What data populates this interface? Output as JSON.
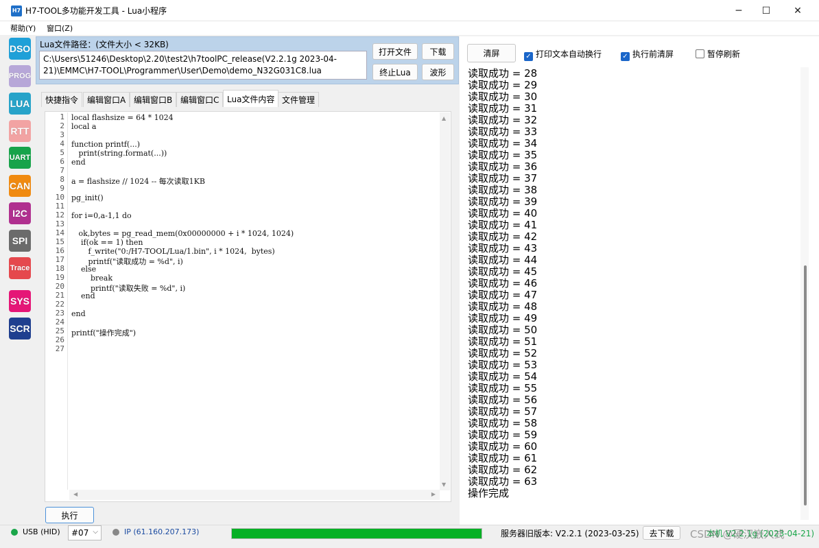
{
  "window": {
    "icon_text": "H7",
    "title": "H7-TOOL多功能开发工具 - Lua小程序",
    "minimize": "─",
    "maximize": "☐",
    "close": "✕"
  },
  "menu": [
    "帮助(Y)",
    "窗口(Z)"
  ],
  "tools": [
    {
      "label": "DSO",
      "color": "#1fa0d8"
    },
    {
      "label": "PROG",
      "color": "#b7a7d8"
    },
    {
      "label": "LUA",
      "color": "#27a3c9"
    },
    {
      "label": "RTT",
      "color": "#f2a3a3"
    },
    {
      "label": "UART",
      "color": "#17a34a"
    },
    {
      "label": "CAN",
      "color": "#f08a10"
    },
    {
      "label": "I2C",
      "color": "#b0308f"
    },
    {
      "label": "SPI",
      "color": "#6b6b6b"
    },
    {
      "label": "Trace",
      "color": "#e5484d"
    },
    {
      "label": "SYS",
      "color": "#e51677"
    },
    {
      "label": "SCR",
      "color": "#1f3f8f"
    }
  ],
  "path": {
    "label": "Lua文件路径：(文件大小 < 32KB)",
    "value_line1": "C:\\Users\\51246\\Desktop\\2.20\\test2\\h7toolPC_release(V2.2.1g 2023-04-",
    "value_line2": "21)\\EMMC\\H7-TOOL\\Programmer\\User\\Demo\\demo_N32G031C8.lua"
  },
  "buttons": {
    "open_file": "打开文件",
    "download": "下载",
    "stop_lua": "终止Lua",
    "waveform": "波形",
    "execute": "执行",
    "clear_screen": "清屏",
    "go_download": "去下载"
  },
  "tabs": [
    "快捷指令",
    "编辑窗口A",
    "编辑窗口B",
    "编辑窗口C",
    "Lua文件内容",
    "文件管理"
  ],
  "active_tab": "Lua文件内容",
  "code_lines": [
    "local flashsize = 64 * 1024",
    "local a",
    "",
    "function printf(...)",
    "   print(string.format(...))",
    "end",
    "",
    "a = flashsize // 1024 -- 每次读取1KB",
    "",
    "pg_init()",
    "",
    "for i=0,a-1,1 do",
    "",
    "   ok,bytes = pg_read_mem(0x00000000 + i * 1024, 1024)",
    "    if(ok == 1) then",
    "       f_write(\"0:/H7-TOOL/Lua/1.bin\", i * 1024,  bytes)",
    "       printf(\"读取成功 = %d\", i)",
    "    else",
    "        break",
    "        printf(\"读取失败 = %d\", i)",
    "    end",
    "",
    "end",
    "",
    "printf(\"操作完成\")",
    "",
    ""
  ],
  "line_numbers": [
    "1",
    "2",
    "3",
    "4",
    "5",
    "6",
    "7",
    "8",
    "9",
    "10",
    "11",
    "12",
    "13",
    "14",
    "15",
    "16",
    "17",
    "18",
    "19",
    "20",
    "21",
    "22",
    "23",
    "24",
    "25",
    "26",
    "27"
  ],
  "options": {
    "auto_wrap": "打印文本自动换行",
    "clear_before_exec": "执行前清屏",
    "pause_refresh": "暂停刷新"
  },
  "output_lines": [
    "读取成功 = 28",
    "读取成功 = 29",
    "读取成功 = 30",
    "读取成功 = 31",
    "读取成功 = 32",
    "读取成功 = 33",
    "读取成功 = 34",
    "读取成功 = 35",
    "读取成功 = 36",
    "读取成功 = 37",
    "读取成功 = 38",
    "读取成功 = 39",
    "读取成功 = 40",
    "读取成功 = 41",
    "读取成功 = 42",
    "读取成功 = 43",
    "读取成功 = 44",
    "读取成功 = 45",
    "读取成功 = 46",
    "读取成功 = 47",
    "读取成功 = 48",
    "读取成功 = 49",
    "读取成功 = 50",
    "读取成功 = 51",
    "读取成功 = 52",
    "读取成功 = 53",
    "读取成功 = 54",
    "读取成功 = 55",
    "读取成功 = 56",
    "读取成功 = 57",
    "读取成功 = 58",
    "读取成功 = 59",
    "读取成功 = 60",
    "读取成功 = 61",
    "读取成功 = 62",
    "读取成功 = 63",
    "操作完成"
  ],
  "status": {
    "usb": "USB (HID)",
    "device": "#07",
    "ip": "IP (61.160.207.173)",
    "progress": 1.0,
    "server_version": "服务器旧版本: V2.2.1 (2023-03-25)",
    "local_version": "本机 V2.2.1g (2023-04-21)",
    "watermark": "CSDN @硬汉嵌入式"
  }
}
